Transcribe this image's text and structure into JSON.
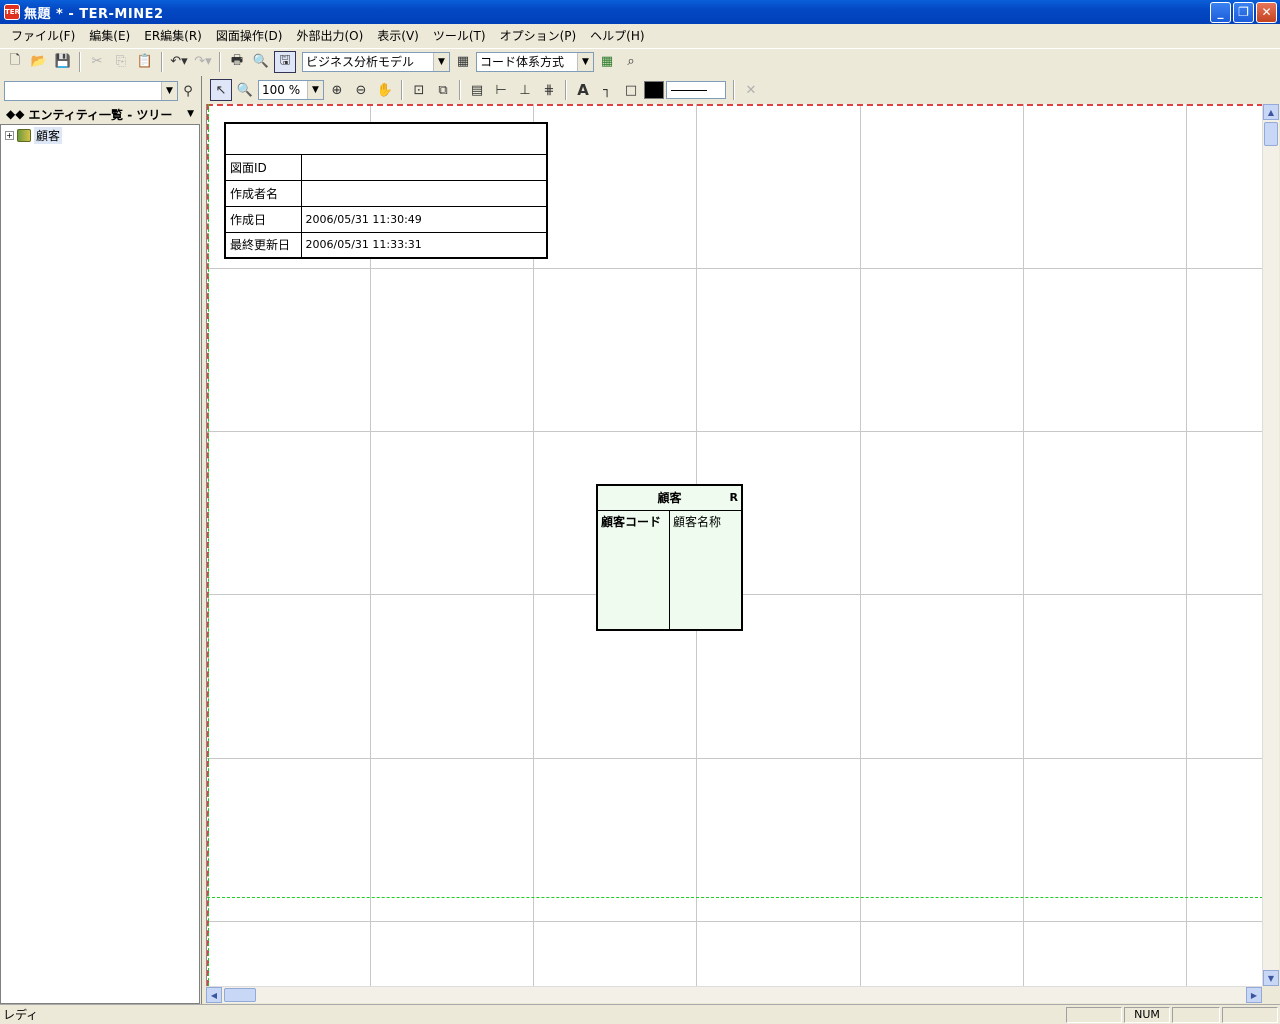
{
  "window": {
    "title": "無題 * - TER-MINE2",
    "app_icon_text": "TER"
  },
  "menu": [
    "ファイル(F)",
    "編集(E)",
    "ER編集(R)",
    "図面操作(D)",
    "外部出力(O)",
    "表示(V)",
    "ツール(T)",
    "オプション(P)",
    "ヘルプ(H)"
  ],
  "toolbar": {
    "model_select": "ビジネス分析モデル",
    "code_select": "コード体系方式",
    "zoom_value": "100 %"
  },
  "left_pane": {
    "combo_value": "",
    "tree_title": "エンティティ一覧 - ツリー",
    "tree_items": [
      {
        "label": "顧客",
        "expander": "+"
      }
    ]
  },
  "info_table": {
    "header": "",
    "rows": [
      {
        "key": "図面ID",
        "value": ""
      },
      {
        "key": "作成者名",
        "value": ""
      },
      {
        "key": "作成日",
        "value": "2006/05/31 11:30:49"
      },
      {
        "key": "最終更新日",
        "value": "2006/05/31 11:33:31"
      }
    ]
  },
  "entity": {
    "name": "顧客",
    "type_mark": "R",
    "pk": "顧客コード",
    "attr": "顧客名称",
    "bg_color": "#eefbee"
  },
  "status": {
    "text": "レディ",
    "num": "NUM"
  }
}
